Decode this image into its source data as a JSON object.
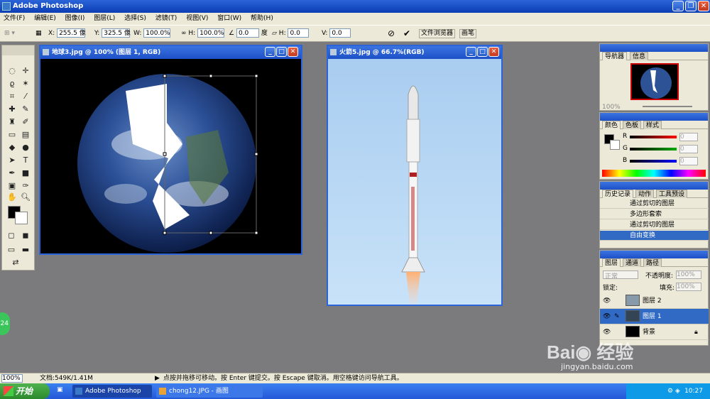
{
  "app": {
    "title": "Adobe Photoshop"
  },
  "menu": [
    "文件(F)",
    "编辑(E)",
    "图像(I)",
    "图层(L)",
    "选择(S)",
    "滤镜(T)",
    "视图(V)",
    "窗口(W)",
    "帮助(H)"
  ],
  "options": {
    "x_label": "X:",
    "x_value": "255.5 像",
    "y_label": "Y:",
    "y_value": "325.5 像",
    "w_label": "W:",
    "w_value": "100.0%",
    "h_label": "H:",
    "h_value": "100.0%",
    "angle_value": "0.0",
    "angle_unit": "度",
    "hskew_label": "H:",
    "hskew_value": "0.0",
    "vskew_label": "V:",
    "vskew_value": "0.0",
    "tab_filebrowser": "文件浏览器",
    "tab_brush": "画笔"
  },
  "doc1": {
    "title": "地球3.jpg @ 100% (图层 1, RGB)"
  },
  "doc2": {
    "title": "火箭5.jpg @ 66.7%(RGB)"
  },
  "navigator": {
    "tabs": [
      "导航器",
      "信息"
    ],
    "zoom": "100%"
  },
  "color": {
    "tabs": [
      "颜色",
      "色板",
      "样式"
    ],
    "r": "R",
    "g": "G",
    "b": "B",
    "r_val": "0",
    "g_val": "0",
    "b_val": "0"
  },
  "history": {
    "tabs": [
      "历史记录",
      "动作",
      "工具预设"
    ],
    "items": [
      "通过剪切的图层",
      "多边形套索",
      "通过剪切的图层",
      "自由变换"
    ]
  },
  "layers": {
    "tabs": [
      "图层",
      "通道",
      "路径"
    ],
    "mode": "正常",
    "opacity_label": "不透明度:",
    "opacity": "100%",
    "lock_label": "锁定:",
    "fill_label": "填充:",
    "fill": "100%",
    "items": [
      "图层 2",
      "图层 1",
      "背景"
    ]
  },
  "status": {
    "zoom": "100%",
    "doc": "文档:549K/1.41M",
    "hint": "点按并拖移可移动。按 Enter 键提交。按 Escape 键取消。用空格键访问导航工具。"
  },
  "taskbar": {
    "start": "开始",
    "task1": "Adobe Photoshop",
    "task2": "chong12.JPG - 画图",
    "time": "10:27"
  },
  "watermark": {
    "site": "jingyan.baidu.com",
    "badge": "24"
  },
  "colors": {
    "title_blue": "#1d50c8",
    "rocket_sky": "#b9d9f4",
    "earth_bg": "#000000"
  }
}
